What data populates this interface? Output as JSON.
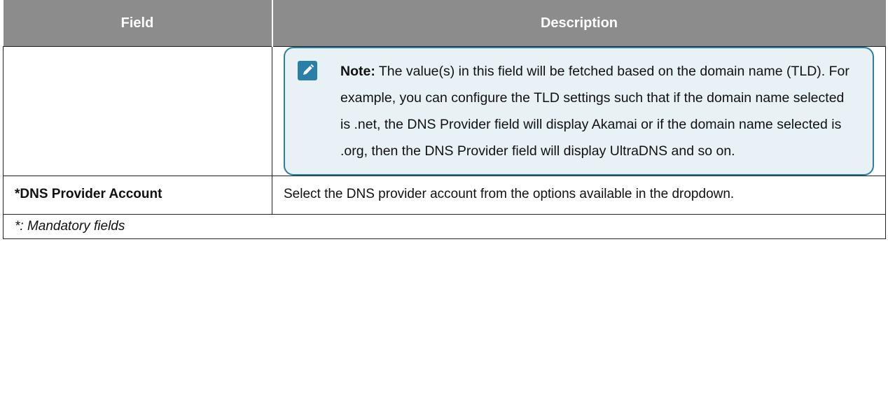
{
  "table": {
    "headers": [
      "Field",
      "Description"
    ],
    "note": {
      "label": "Note:",
      "text": " The value(s) in this field will be fetched based on the domain name (TLD). For example, you can configure the TLD settings such that if the domain name selected is .net, the DNS Provider field will display Akamai or if the domain name selected is .org, then the DNS Provider field will display UltraDNS and so on."
    },
    "rows": [
      {
        "field": "*DNS Provider Account",
        "description": "Select the DNS provider account from the options available in the dropdown."
      }
    ],
    "footer": "*: Mandatory fields"
  },
  "icons": {
    "note": "edit-pencil-icon"
  },
  "colors": {
    "header_bg": "#8c8c8c",
    "note_bg": "#e8f1f6",
    "note_border": "#2a7fa9"
  }
}
